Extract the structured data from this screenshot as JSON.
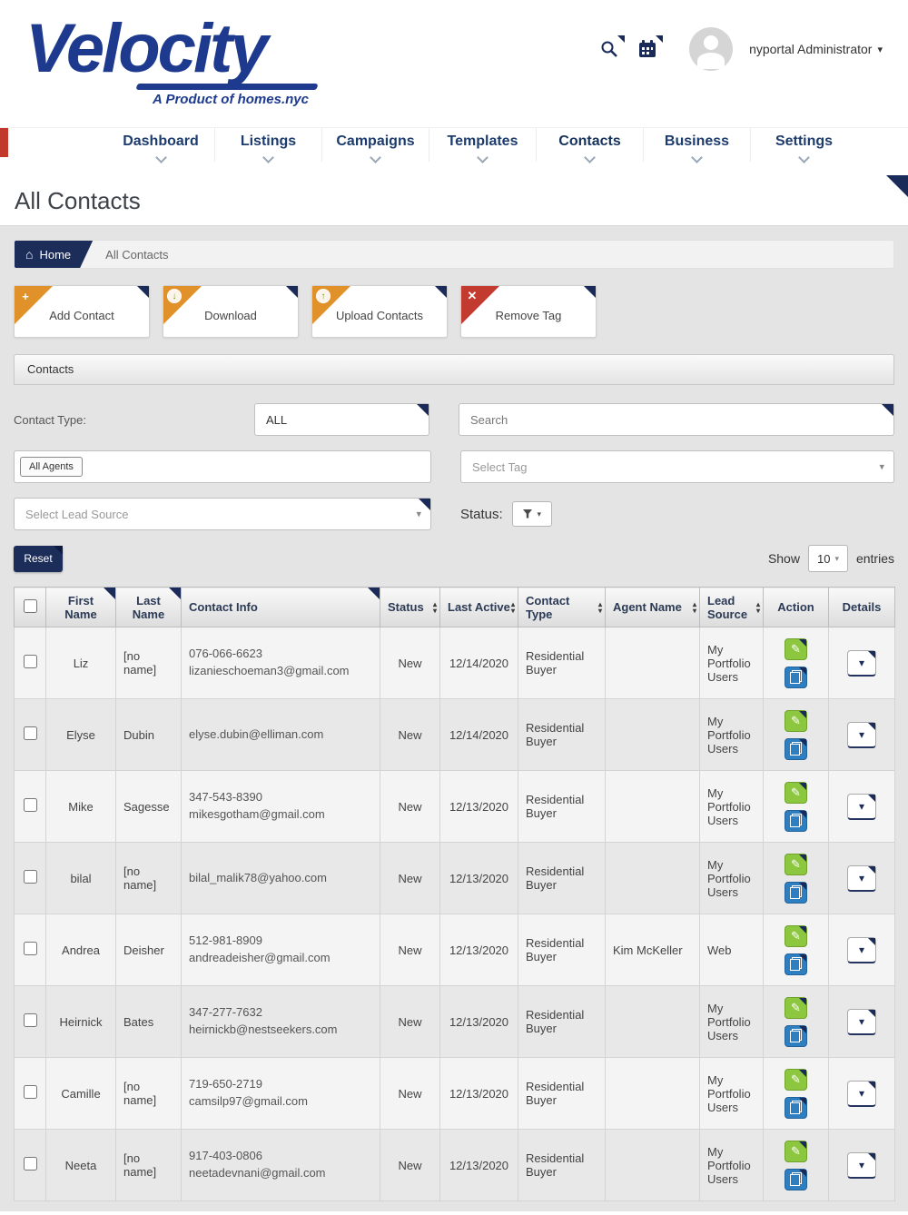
{
  "colors": {
    "navy": "#1a2b5a",
    "brand_blue": "#1d3a8f",
    "corner_orange": "#e0912a",
    "corner_red": "#c23b2e",
    "action_green": "#8dc63f",
    "action_blue": "#2e7fc1",
    "nav_accent_red": "#c0392b"
  },
  "icons": {
    "plus": "+",
    "download_arrow": "↓",
    "upload_arrow": "↑",
    "remove": "✕",
    "caret_down": "▾",
    "sort_asc": "▴",
    "sort_desc": "▾",
    "pencil": "✎",
    "home": "⌂"
  },
  "brand": {
    "logo_text": "Velocity",
    "tagline": "A Product of homes.nyc"
  },
  "header": {
    "user_menu": "nyportal Administrator"
  },
  "nav": {
    "items": [
      "Dashboard",
      "Listings",
      "Campaigns",
      "Templates",
      "Contacts",
      "Business",
      "Settings"
    ],
    "active": "Contacts"
  },
  "page": {
    "title": "All Contacts",
    "breadcrumb": {
      "home": "Home",
      "current": "All Contacts"
    }
  },
  "actions": [
    {
      "label": "Add Contact",
      "icon": "plus-icon",
      "corner_color": "#e0912a"
    },
    {
      "label": "Download",
      "icon": "download-circle-icon",
      "corner_color": "#e0912a"
    },
    {
      "label": "Upload Contacts",
      "icon": "upload-circle-icon",
      "corner_color": "#e0912a"
    },
    {
      "label": "Remove Tag",
      "icon": "remove-icon",
      "corner_color": "#c23b2e"
    }
  ],
  "panel": {
    "title": "Contacts"
  },
  "filters": {
    "contact_type_label": "Contact Type:",
    "contact_type_value": "ALL",
    "search_placeholder": "Search",
    "agents_button": "All Agents",
    "tag_placeholder": "Select Tag",
    "lead_source_placeholder": "Select Lead Source",
    "status_label": "Status:",
    "reset_button": "Reset",
    "show_label": "Show",
    "page_size": "10",
    "entries_label": "entries"
  },
  "table": {
    "headers": [
      "First Name",
      "Last Name",
      "Contact Info",
      "Status",
      "Last Active",
      "Contact Type",
      "Agent Name",
      "Lead Source",
      "Action",
      "Details"
    ],
    "rows": [
      {
        "first_name": "Liz",
        "last_name": "[no name]",
        "phone": "076-066-6623",
        "email": "lizanieschoeman3@gmail.com",
        "status": "New",
        "last_active": "12/14/2020",
        "contact_type": "Residential Buyer",
        "agent_name": "",
        "lead_source": "My Portfolio Users"
      },
      {
        "first_name": "Elyse",
        "last_name": "Dubin",
        "phone": "",
        "email": "elyse.dubin@elliman.com",
        "status": "New",
        "last_active": "12/14/2020",
        "contact_type": "Residential Buyer",
        "agent_name": "",
        "lead_source": "My Portfolio Users"
      },
      {
        "first_name": "Mike",
        "last_name": "Sagesse",
        "phone": "347-543-8390",
        "email": "mikesgotham@gmail.com",
        "status": "New",
        "last_active": "12/13/2020",
        "contact_type": "Residential Buyer",
        "agent_name": "",
        "lead_source": "My Portfolio Users"
      },
      {
        "first_name": "bilal",
        "last_name": "[no name]",
        "phone": "",
        "email": "bilal_malik78@yahoo.com",
        "status": "New",
        "last_active": "12/13/2020",
        "contact_type": "Residential Buyer",
        "agent_name": "",
        "lead_source": "My Portfolio Users"
      },
      {
        "first_name": "Andrea",
        "last_name": "Deisher",
        "phone": "512-981-8909",
        "email": "andreadeisher@gmail.com",
        "status": "New",
        "last_active": "12/13/2020",
        "contact_type": "Residential Buyer",
        "agent_name": "Kim McKeller",
        "lead_source": "Web"
      },
      {
        "first_name": "Heirnick",
        "last_name": "Bates",
        "phone": "347-277-7632",
        "email": "heirnickb@nestseekers.com",
        "status": "New",
        "last_active": "12/13/2020",
        "contact_type": "Residential Buyer",
        "agent_name": "",
        "lead_source": "My Portfolio Users"
      },
      {
        "first_name": "Camille",
        "last_name": "[no name]",
        "phone": "719-650-2719",
        "email": "camsilp97@gmail.com",
        "status": "New",
        "last_active": "12/13/2020",
        "contact_type": "Residential Buyer",
        "agent_name": "",
        "lead_source": "My Portfolio Users"
      },
      {
        "first_name": "Neeta",
        "last_name": "[no name]",
        "phone": "917-403-0806",
        "email": "neetadevnani@gmail.com",
        "status": "New",
        "last_active": "12/13/2020",
        "contact_type": "Residential Buyer",
        "agent_name": "",
        "lead_source": "My Portfolio Users"
      }
    ]
  }
}
